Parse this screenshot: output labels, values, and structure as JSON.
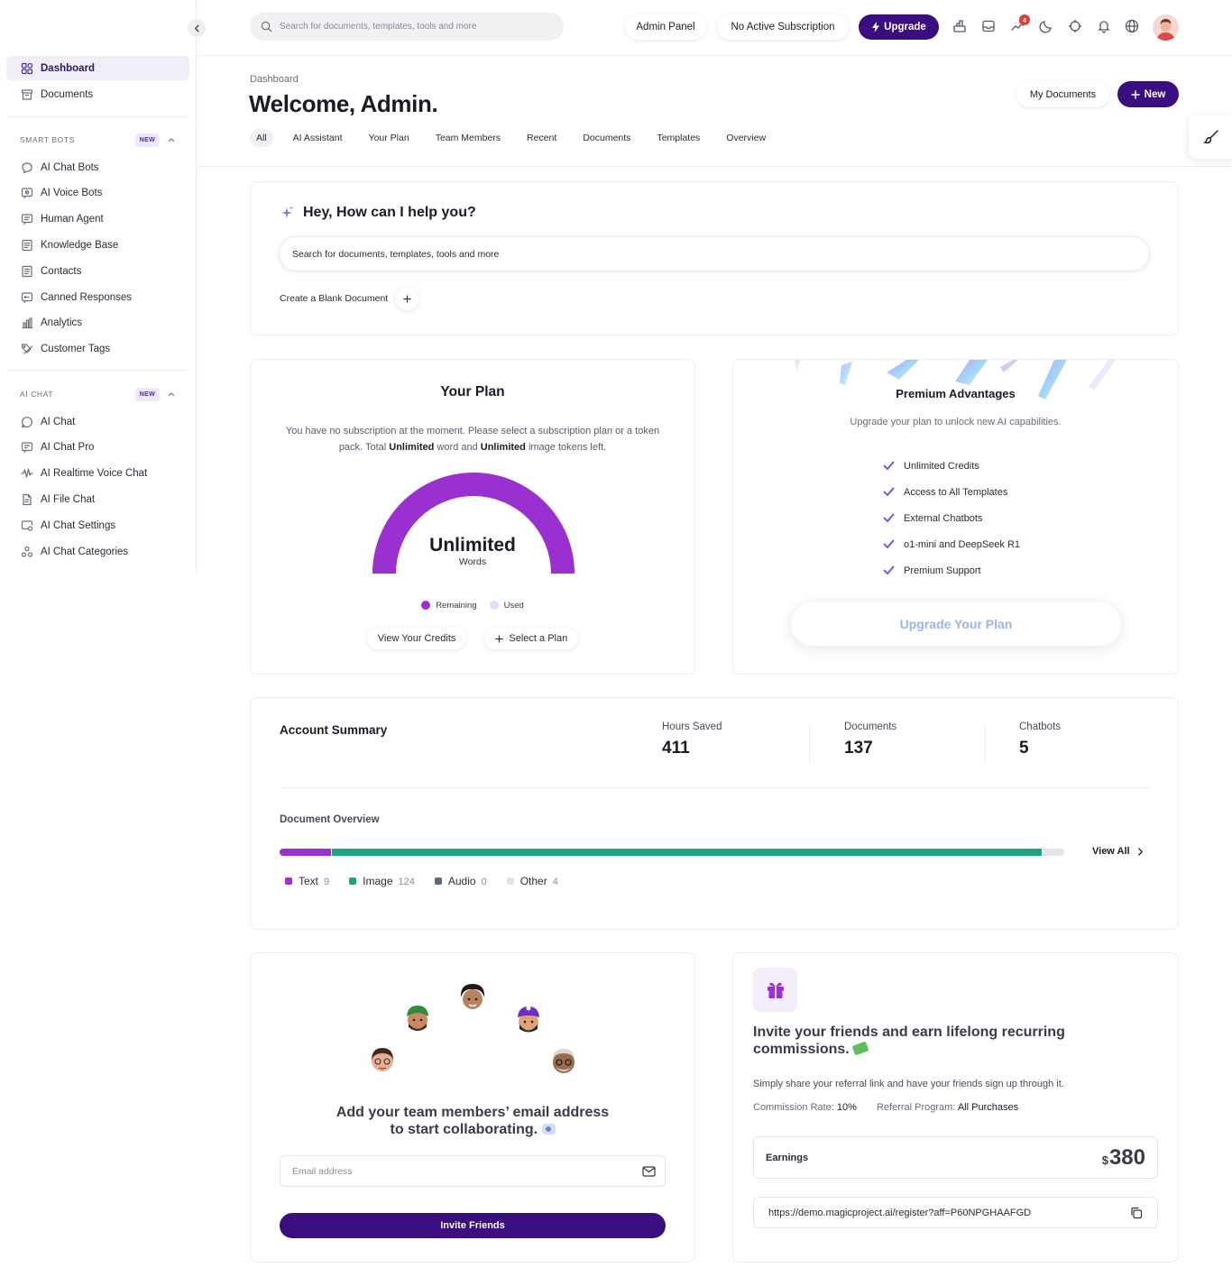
{
  "sidebar": {
    "items_top": [
      {
        "label": "Dashboard",
        "icon": "grid-icon",
        "active": true
      },
      {
        "label": "Documents",
        "icon": "archive-icon"
      }
    ],
    "sections": [
      {
        "title": "SMART BOTS",
        "badge": "NEW",
        "items": [
          {
            "label": "AI Chat Bots",
            "icon": "chat-bubble-icon"
          },
          {
            "label": "AI Voice Bots",
            "icon": "voice-chat-icon"
          },
          {
            "label": "Human Agent",
            "icon": "message-square-icon"
          },
          {
            "label": "Knowledge Base",
            "icon": "book-icon"
          },
          {
            "label": "Contacts",
            "icon": "contacts-icon"
          },
          {
            "label": "Canned Responses",
            "icon": "reply-icon"
          },
          {
            "label": "Analytics",
            "icon": "bar-chart-icon"
          },
          {
            "label": "Customer Tags",
            "icon": "tags-icon"
          }
        ]
      },
      {
        "title": "AI CHAT",
        "badge": "NEW",
        "items": [
          {
            "label": "AI Chat",
            "icon": "chat-circle-icon"
          },
          {
            "label": "AI Chat Pro",
            "icon": "chat-pro-icon"
          },
          {
            "label": "AI Realtime Voice Chat",
            "icon": "waveform-icon"
          },
          {
            "label": "AI File Chat",
            "icon": "file-chat-icon"
          },
          {
            "label": "AI Chat Settings",
            "icon": "chat-settings-icon"
          },
          {
            "label": "AI Chat Categories",
            "icon": "categories-icon"
          }
        ]
      }
    ]
  },
  "topbar": {
    "search_placeholder": "Search for documents, templates, tools and more",
    "admin_panel": "Admin Panel",
    "subscription": "No Active Subscription",
    "upgrade": "Upgrade",
    "notifications_count": "4"
  },
  "header": {
    "breadcrumb": "Dashboard",
    "welcome": "Welcome, Admin.",
    "my_documents": "My Documents",
    "new_button": "New",
    "tabs": [
      "All",
      "AI Assistant",
      "Your Plan",
      "Team Members",
      "Recent",
      "Documents",
      "Templates",
      "Overview"
    ]
  },
  "help": {
    "title": "Hey, How can I help you?",
    "search_placeholder": "Search for documents, templates, tools and more",
    "blank_document": "Create a Blank Document"
  },
  "plan": {
    "title": "Your Plan",
    "desc_1": "You have no subscription at the moment. Please select a subscription plan or a token pack. Total ",
    "desc_b1": "Unlimited",
    "desc_2": " word and ",
    "desc_b2": "Unlimited",
    "desc_3": " image tokens left.",
    "gauge_value": "Unlimited",
    "gauge_unit": "Words",
    "gauge_remaining_fraction": 1.0,
    "legend_remaining": "Remaining",
    "legend_used": "Used",
    "view_credits": "View Your Credits",
    "select_plan": "Select a Plan",
    "colors": {
      "remaining": "#9b30d0",
      "used": "#ead9f7"
    }
  },
  "premium": {
    "title": "Premium Advantages",
    "subtitle": "Upgrade your plan to unlock new AI capabilities.",
    "items": [
      "Unlimited Credits",
      "Access to All Templates",
      "External Chatbots",
      "o1-mini and DeepSeek R1",
      "Premium Support"
    ],
    "cta": "Upgrade Your Plan"
  },
  "account": {
    "title": "Account Summary",
    "stats": [
      {
        "label": "Hours Saved",
        "value": "411"
      },
      {
        "label": "Documents",
        "value": "137"
      },
      {
        "label": "Chatbots",
        "value": "5"
      }
    ],
    "doc_overview_title": "Document Overview",
    "view_all": "View All",
    "doc_types": [
      {
        "label": "Text",
        "count": 9,
        "color": "#9b30d0"
      },
      {
        "label": "Image",
        "count": 124,
        "color": "#1fa37f"
      },
      {
        "label": "Audio",
        "count": 0,
        "color": "#5d6a7f"
      },
      {
        "label": "Other",
        "count": 4,
        "color": "#e4e4ea"
      }
    ]
  },
  "team": {
    "heading_1": "Add your team members’ email address",
    "heading_2": "to start collaborating.",
    "email_placeholder": "Email address",
    "invite_button": "Invite Friends"
  },
  "referral": {
    "heading": "Invite your friends and earn lifelong recurring commissions.",
    "description": "Simply share your referral link and have your friends sign up through it.",
    "commission_label": "Commission Rate:",
    "commission_value": "10%",
    "program_label": "Referral Program:",
    "program_value": "All Purchases",
    "earnings_label": "Earnings",
    "earnings_currency": "$",
    "earnings_value": "380",
    "link": "https://demo.magicproject.ai/register?aff=P60NPGHAAFGD"
  }
}
